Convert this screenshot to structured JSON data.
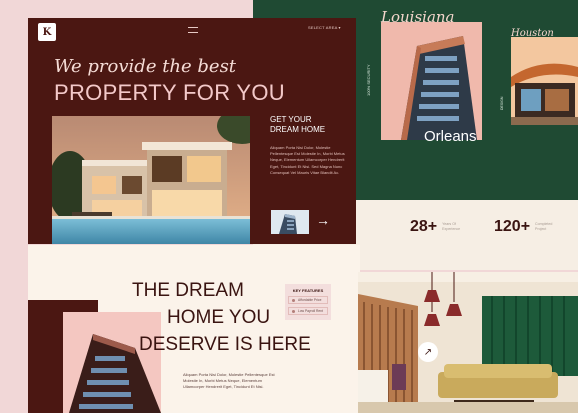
{
  "hero": {
    "logo": "K",
    "nav_select": "SELECT AREA ▾",
    "headline_italic": "We provide the best",
    "headline_main": "PROPERTY FOR YOU",
    "cta_title_1": "GET YOUR",
    "cta_title_2": "DREAM HOME",
    "description": "Aliquam Porta Nisi Dolor, Molestie Pellentesque Est Molestie In, Morbi Metus Neque, Elementum Ullamcorper Hendrerit Eget, Tincidunt Et Nisi. Sed Magna Nunc Consequat Vel Mauris Vitae Blandit Ac."
  },
  "louisiana": {
    "script": "Louisiana",
    "city": "Orleans",
    "vertical": "100% SECURITY"
  },
  "houston": {
    "script": "Houston",
    "vertical": "DESIGN"
  },
  "stats": [
    {
      "value": "28+",
      "label_1": "Years Of",
      "label_2": "Experience"
    },
    {
      "value": "120+",
      "label_1": "Completed",
      "label_2": "Project"
    }
  ],
  "dream": {
    "line_1": "THE DREAM",
    "line_2": "HOME YOU",
    "line_3": "DESERVE IS HERE",
    "description": "Aliquam Porta Nisi Dolor, Molestie Pellentesque Est Molestie In, Morbi Metus Neque, Elementum Ullamcorper Hendrerit Eget, Tincidunt Et Nisi."
  },
  "features": {
    "heading": "KEY FEATURES",
    "items": [
      "Affordable Price",
      "Low Payroll Rent"
    ]
  },
  "colors": {
    "maroon": "#4b1712",
    "green": "#1f4a33",
    "pink": "#f1d7d7",
    "cream": "#fbf3ea"
  },
  "icons": {
    "arrow": "arrow-right-icon",
    "menu": "menu-icon",
    "expand": "arrow-up-right-icon"
  }
}
